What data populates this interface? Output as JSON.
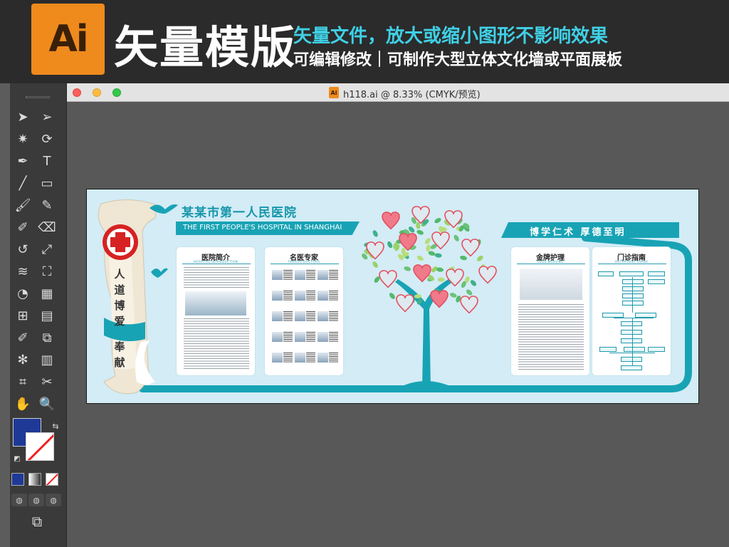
{
  "banner": {
    "ai_logo": "Ai",
    "title": "矢量模版",
    "subtitle_1": "矢量文件，放大或缩小图形不影响效果",
    "subtitle_2": "可编辑修改｜可制作大型立体文化墙或平面展板"
  },
  "window": {
    "doc_icon_label": "Ai",
    "title": "h118.ai @ 8.33% (CMYK/预览)"
  },
  "tools": [
    "selection-tool",
    "direct-selection-tool",
    "magic-wand-tool",
    "lasso-tool",
    "pen-tool",
    "type-tool",
    "line-tool",
    "rectangle-tool",
    "paintbrush-tool",
    "pencil-tool",
    "blob-brush-tool",
    "eraser-tool",
    "rotate-tool",
    "scale-tool",
    "warp-tool",
    "free-transform-tool",
    "shape-builder-tool",
    "perspective-grid-tool",
    "mesh-tool",
    "gradient-tool",
    "eyedropper-tool",
    "blend-tool",
    "symbol-sprayer-tool",
    "column-graph-tool",
    "artboard-tool",
    "slice-tool",
    "hand-tool",
    "zoom-tool"
  ],
  "colors": {
    "fill": "#1e3a96",
    "stroke": "#ffffff",
    "accent": "#18a3b5",
    "wall_bg": "#d3ecf6"
  },
  "artwork": {
    "hospital_name": "某某市第一人民医院",
    "hospital_name_en": "THE FIRST PEOPLE'S HOSPITAL IN SHANGHAI",
    "motto": "博学仁术 厚德至明",
    "scroll_text": [
      "人",
      "道",
      "博",
      "爱",
      "奉",
      "献"
    ],
    "panels": [
      {
        "title": "医院简介",
        "subtitle": "HOSPITAL INTRODUCTION"
      },
      {
        "title": "名医专家",
        "subtitle": "FAMOUS DOCTORS"
      },
      {
        "title": "金牌护理",
        "subtitle": "GOLD NURSING"
      },
      {
        "title": "门诊指南",
        "subtitle": "OUTPATIENT GUIDE"
      }
    ]
  }
}
